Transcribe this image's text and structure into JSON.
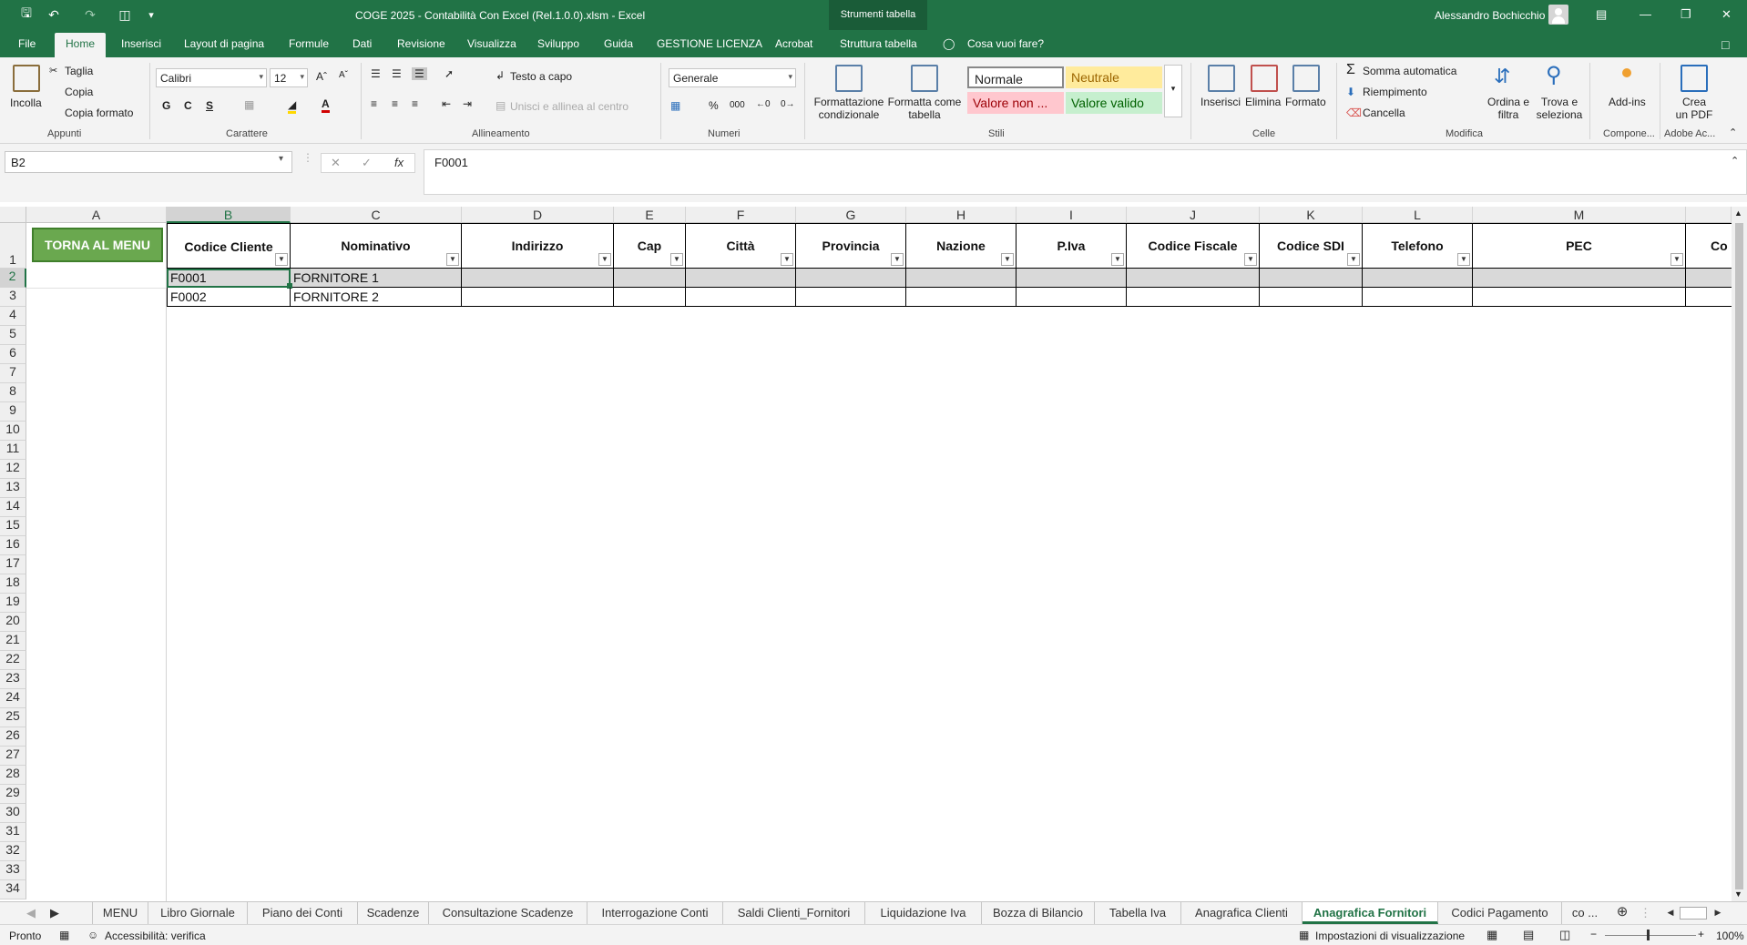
{
  "app": {
    "title": "COGE 2025 - Contabilità Con Excel (Rel.1.0.0).xlsm  -  Excel",
    "context_tools": "Strumenti tabella",
    "user": "Alessandro Bochicchio"
  },
  "ribbon_tabs": [
    "File",
    "Home",
    "Inserisci",
    "Layout di pagina",
    "Formule",
    "Dati",
    "Revisione",
    "Visualizza",
    "Sviluppo",
    "Guida",
    "GESTIONE LICENZA",
    "Acrobat",
    "Struttura tabella"
  ],
  "tell_me": "Cosa vuoi fare?",
  "ribbon": {
    "clipboard": {
      "paste": "Incolla",
      "cut": "Taglia",
      "copy": "Copia",
      "format_painter": "Copia formato",
      "label": "Appunti"
    },
    "font": {
      "name": "Calibri",
      "size": "12",
      "bold": "G",
      "italic": "C",
      "underline": "S",
      "label": "Carattere"
    },
    "alignment": {
      "wrap": "Testo a capo",
      "merge": "Unisci e allinea al centro",
      "label": "Allineamento"
    },
    "number": {
      "format": "Generale",
      "percent": "%",
      "thousands": "000",
      "label": "Numeri"
    },
    "styles": {
      "conditional": [
        "Formattazione",
        "condizionale"
      ],
      "as_table": [
        "Formatta come",
        "tabella"
      ],
      "normal": "Normale",
      "neutral": "Neutrale",
      "bad": "Valore non ...",
      "good": "Valore valido",
      "label": "Stili"
    },
    "cells": {
      "insert": "Inserisci",
      "delete": "Elimina",
      "format": "Formato",
      "label": "Celle"
    },
    "editing": {
      "autosum": "Somma automatica",
      "fill": "Riempimento",
      "clear": "Cancella",
      "sort": [
        "Ordina e",
        "filtra"
      ],
      "find": [
        "Trova e",
        "seleziona"
      ],
      "label": "Modifica"
    },
    "addins": {
      "label_btn": "Add-ins",
      "label": "Compone..."
    },
    "pdf": {
      "label_btn": [
        "Crea",
        "un PDF"
      ],
      "label": "Adobe Ac..."
    }
  },
  "formula_bar": {
    "name_box": "B2",
    "value": "F0001",
    "fx": "fx"
  },
  "sheet": {
    "columns": [
      "A",
      "B",
      "C",
      "D",
      "E",
      "F",
      "G",
      "H",
      "I",
      "J",
      "K",
      "L",
      "M"
    ],
    "rows": [
      "1",
      "2",
      "3",
      "4",
      "5",
      "6",
      "7",
      "8",
      "9",
      "10",
      "11",
      "12",
      "13",
      "14",
      "15",
      "16",
      "17",
      "18",
      "19",
      "20",
      "21",
      "22",
      "23",
      "24",
      "25",
      "26",
      "27",
      "28",
      "29",
      "30",
      "31",
      "32",
      "33",
      "34"
    ],
    "menu_button": "TORNA AL MENU",
    "headers": [
      "Codice Cliente",
      "Nominativo",
      "Indirizzo",
      "Cap",
      "Città",
      "Provincia",
      "Nazione",
      "P.Iva",
      "Codice Fiscale",
      "Codice SDI",
      "Telefono",
      "PEC",
      "Co"
    ],
    "data": [
      [
        "F0001",
        "FORNITORE 1"
      ],
      [
        "F0002",
        "FORNITORE 2"
      ]
    ]
  },
  "sheet_tabs": [
    "MENU",
    "Libro Giornale",
    "Piano dei Conti",
    "Scadenze",
    "Consultazione Scadenze",
    "Interrogazione Conti",
    "Saldi Clienti_Fornitori",
    "Liquidazione Iva",
    "Bozza di Bilancio",
    "Tabella Iva",
    "Anagrafica Clienti",
    "Anagrafica Fornitori",
    "Codici Pagamento",
    "co ..."
  ],
  "active_sheet": "Anagrafica Fornitori",
  "status": {
    "ready": "Pronto",
    "accessibility": "Accessibilità: verifica",
    "view_settings": "Impostazioni di visualizzazione",
    "zoom": "100%"
  },
  "colors": {
    "excel_green": "#217346",
    "menu_button": "#6aa84f",
    "neutral": "#ffeb9c",
    "bad": "#ffc7ce",
    "good": "#c6efce"
  }
}
